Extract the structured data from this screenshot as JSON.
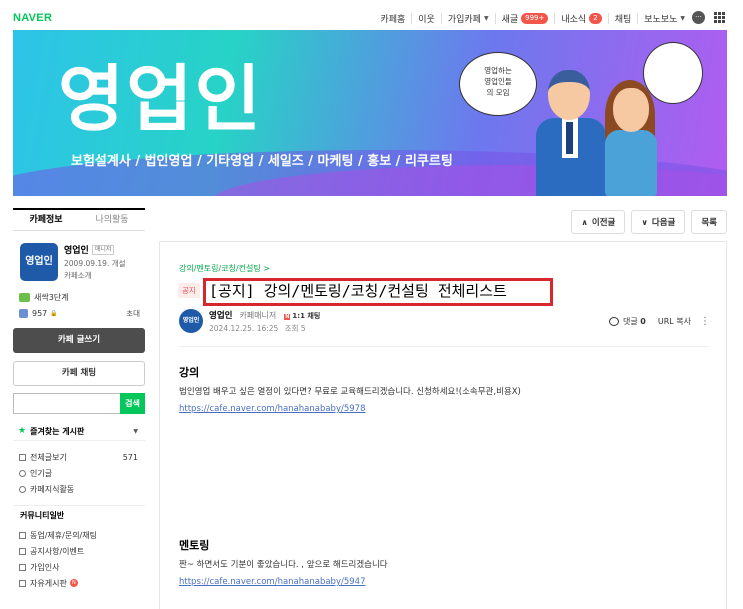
{
  "topbar": {
    "logo": "NAVER",
    "nav": {
      "cafe_home": "카페홈",
      "neighbors": "이웃",
      "joined_cafe": "가입카페",
      "new_posts": "새글",
      "new_posts_badge": "999+",
      "news": "내소식",
      "news_badge": "2",
      "chat": "채팅",
      "user": "보노보노"
    }
  },
  "banner": {
    "title": "영업인",
    "subtitle": "보험설계사 / 법인영업 / 기타영업 / 세일즈 / 마케팅 / 홍보 / 리쿠르팅",
    "bubble_man": "영업하는\n영업인들\n의 모임",
    "bubble_woman": ""
  },
  "sidebar": {
    "tabs": [
      "카페정보",
      "나의활동"
    ],
    "cafe": {
      "logo_text": "영업인",
      "name": "영업인",
      "manager_badge": "매니저",
      "founded": "2009.09.19. 개설",
      "intro": "카페소개"
    },
    "rank": "새싹3단계",
    "members": "957",
    "invite": "초대",
    "write_button": "카페 글쓰기",
    "chat_button": "카페 채팅",
    "search_button": "검색",
    "favorites": "즐겨찾는 게시판",
    "menu": [
      {
        "label": "전체글보기",
        "count": "571"
      },
      {
        "label": "인기글",
        "count": ""
      },
      {
        "label": "카페지식활동",
        "count": ""
      }
    ],
    "community_title": "커뮤니티일반",
    "community": [
      {
        "label": "동업/제휴/문의/채팅"
      },
      {
        "label": "공지사항/이벤트"
      },
      {
        "label": "가입인사"
      },
      {
        "label": "자유게시판"
      }
    ]
  },
  "article_nav": {
    "prev": "이전글",
    "next": "다음글",
    "list": "목록"
  },
  "article": {
    "breadcrumb": "강의/멘토링/코칭/컨설팅 >",
    "notice_tag": "공지",
    "title": "[공지] 강의/멘토링/코칭/컨설팅 전체리스트",
    "author": "영업인",
    "author_role": "카페매니저",
    "chat_tag": "1:1 채팅",
    "date": "2024.12.25. 16:25",
    "views": "조회 5",
    "comments_label": "댓글",
    "comments_count": "0",
    "url_copy": "URL 복사",
    "sections": [
      {
        "heading": "강의",
        "text": "법인영업 배우고 싶은 열정이 있다면? 무료로 교육해드리겠습니다. 신청하세요!(소속무관,비용X)",
        "link": "https://cafe.naver.com/hanahanababy/5978"
      },
      {
        "heading": "멘토링",
        "text": "짠~ 하면서도 기분이 좋았습니다. , 앞으로 해드리겠습니다",
        "link": "https://cafe.naver.com/hanahanababy/5947"
      }
    ]
  },
  "colors": {
    "naver_green": "#03c75a",
    "highlight_red": "#d7262c",
    "link_blue": "#4a6fc2"
  }
}
